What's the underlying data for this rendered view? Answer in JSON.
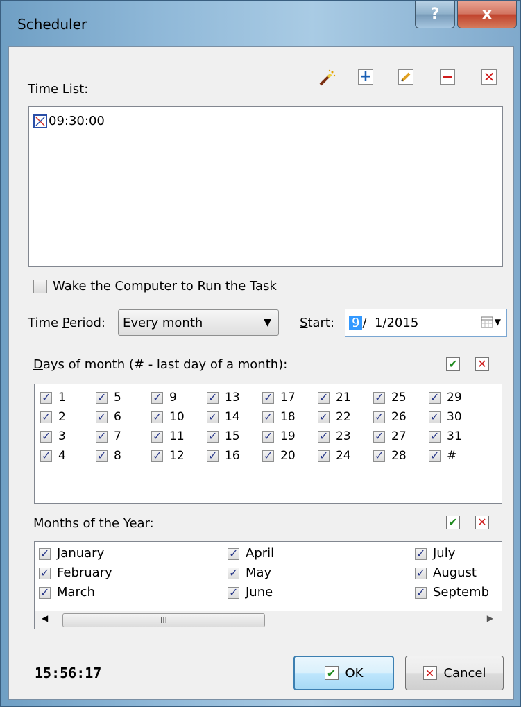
{
  "window": {
    "title": "Scheduler",
    "help_label": "?",
    "close_label": "x"
  },
  "time_list": {
    "label": "Time List:",
    "items": [
      "09:30:00"
    ],
    "toolbar": [
      "wizard-icon",
      "add-icon",
      "edit-icon",
      "remove-icon",
      "delete-all-icon"
    ]
  },
  "wake": {
    "label": "Wake the Computer to Run the Task",
    "checked": false
  },
  "period": {
    "label_pre": "Time ",
    "label_ul": "P",
    "label_post": "eriod:",
    "value": "Every month",
    "start_ul": "S",
    "start_post": "tart:",
    "date_month": "9",
    "date_rest": "/  1/2015"
  },
  "days": {
    "label_ul": "D",
    "label_post": "ays of month (# - last day of a month):",
    "items": [
      "1",
      "2",
      "3",
      "4",
      "5",
      "6",
      "7",
      "8",
      "9",
      "10",
      "11",
      "12",
      "13",
      "14",
      "15",
      "16",
      "17",
      "18",
      "19",
      "20",
      "21",
      "22",
      "23",
      "24",
      "25",
      "26",
      "27",
      "28",
      "29",
      "30",
      "31",
      "#"
    ]
  },
  "months": {
    "label": "Months of the Year:",
    "items": [
      "January",
      "February",
      "March",
      "April",
      "May",
      "June",
      "July",
      "August",
      "Septemb"
    ]
  },
  "scroll": {
    "thumb_grip": "III"
  },
  "footer": {
    "clock": "15:56:17",
    "ok_label": "OK",
    "cancel_label": "Cancel"
  },
  "colors": {
    "check_green": "#1f8a1f",
    "cross_red": "#d01c1c",
    "add_blue": "#1a5fb4"
  }
}
